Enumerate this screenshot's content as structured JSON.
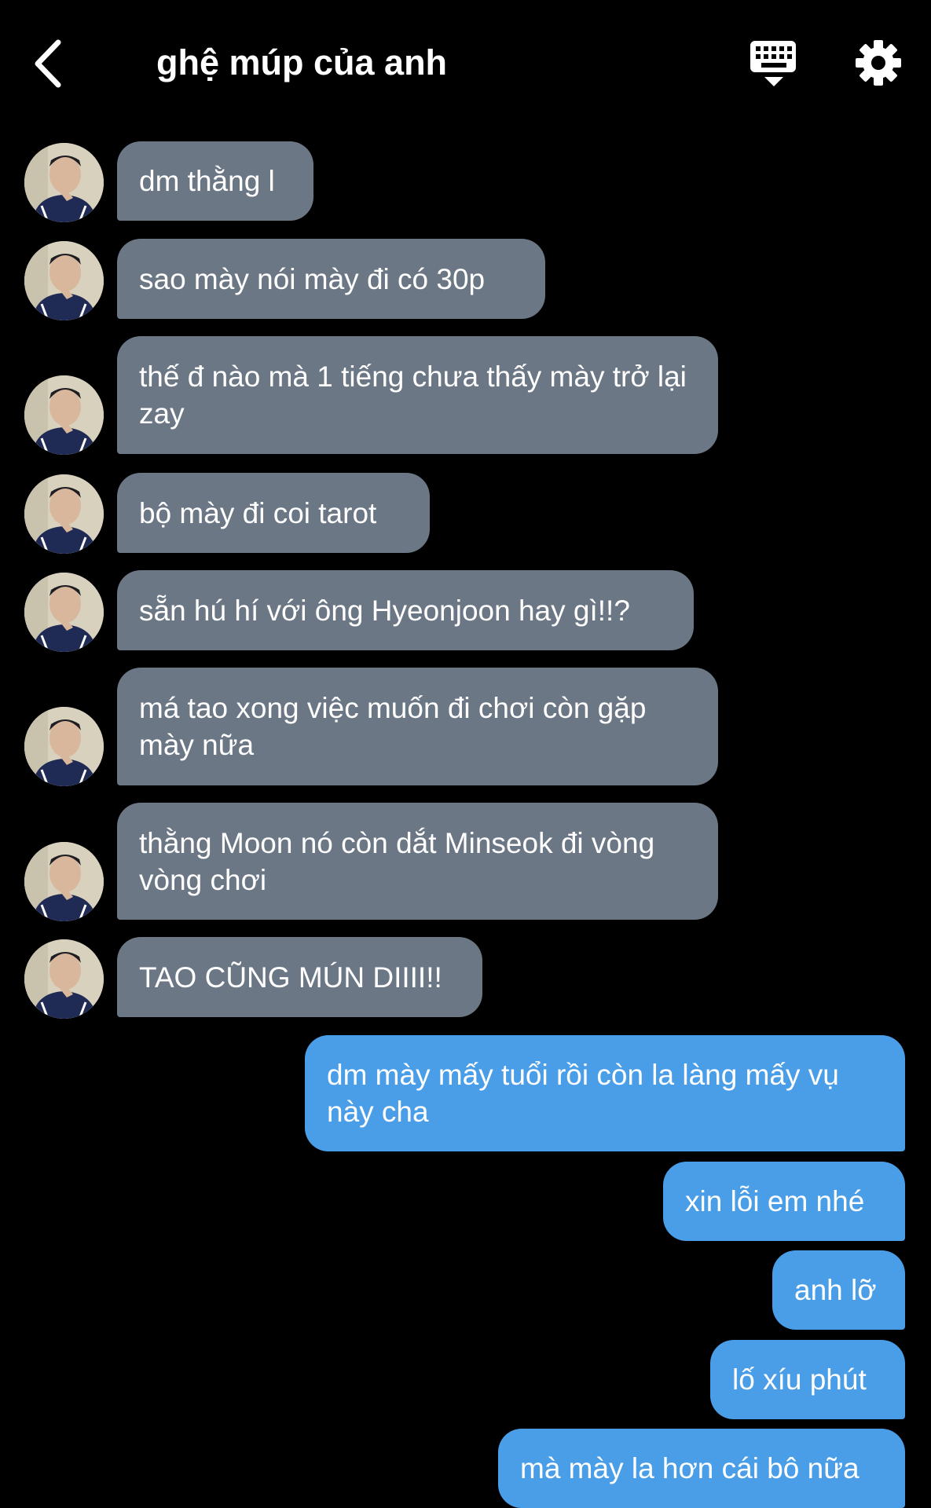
{
  "header": {
    "title": "ghệ múp của anh"
  },
  "icons": {
    "back": "chevron-left-icon",
    "keyboard": "keyboard-icon",
    "settings": "gear-icon"
  },
  "colors": {
    "background": "#000000",
    "incoming_bubble": "#6c7786",
    "outgoing_bubble": "#4a9ee8",
    "text": "#ffffff"
  },
  "messages": [
    {
      "side": "in",
      "text": "dm thằng l"
    },
    {
      "side": "in",
      "text": "sao mày nói mày đi có 30p"
    },
    {
      "side": "in",
      "text": "thế đ nào mà 1 tiếng chưa thấy mày trở lại zay"
    },
    {
      "side": "in",
      "text": "bộ mày đi coi tarot"
    },
    {
      "side": "in",
      "text": "sẵn hú hí với ông Hyeonjoon hay gì!!?"
    },
    {
      "side": "in",
      "text": "má tao xong việc muốn đi chơi còn gặp mày nữa"
    },
    {
      "side": "in",
      "text": "thằng Moon nó còn dắt Minseok đi vòng vòng chơi"
    },
    {
      "side": "in",
      "text": "TAO CŨNG MÚN DIIII!!"
    },
    {
      "side": "out",
      "text": "dm mày mấy tuổi rồi còn la làng mấy vụ này cha"
    },
    {
      "side": "out",
      "text": "xin lỗi em nhé"
    },
    {
      "side": "out",
      "text": "anh lỡ"
    },
    {
      "side": "out",
      "text": "lố xíu phút"
    },
    {
      "side": "out",
      "text": "mà mày la hơn cái bô nữa"
    }
  ]
}
